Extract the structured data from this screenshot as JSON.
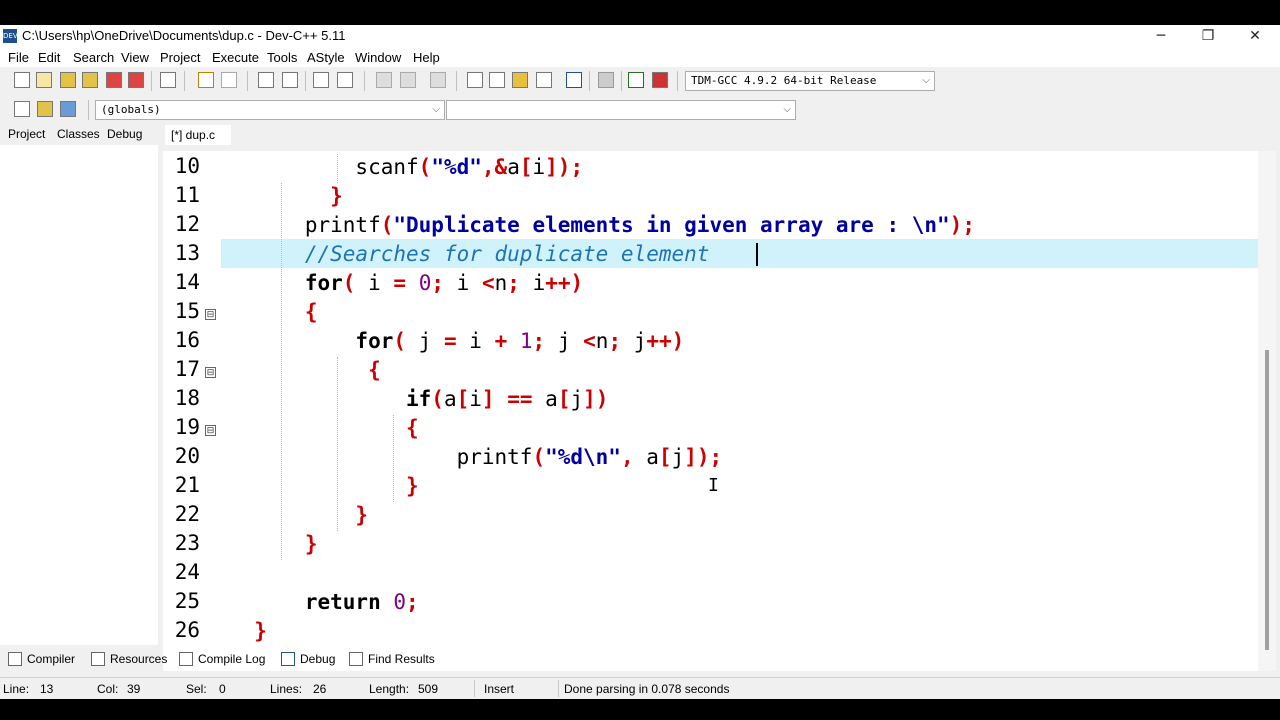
{
  "window": {
    "title": "C:\\Users\\hp\\OneDrive\\Documents\\dup.c - Dev-C++ 5.11",
    "app_icon": "DEV",
    "controls": [
      "─",
      "❐",
      "✕"
    ]
  },
  "menu": [
    "File",
    "Edit",
    "Search",
    "View",
    "Project",
    "Execute",
    "Tools",
    "AStyle",
    "Window",
    "Help"
  ],
  "toolbar": {
    "compiler_select": "TDM-GCC 4.9.2 64-bit Release",
    "scope_select": "(globals)",
    "function_select": ""
  },
  "left_tabs": [
    "Project",
    "Classes",
    "Debug"
  ],
  "editor_tab": "[*] dup.c",
  "editor": {
    "line_numbers": [
      "10",
      "11",
      "12",
      "13",
      "14",
      "15",
      "16",
      "17",
      "18",
      "19",
      "20",
      "21",
      "22",
      "23",
      "24",
      "25",
      "26"
    ],
    "fold_markers": [
      "⊟",
      "⊟",
      "⊟"
    ],
    "lines": [
      [
        {
          "t": "          scanf"
        },
        {
          "c": "sym",
          "t": "("
        },
        {
          "c": "str",
          "t": "\"%d\""
        },
        {
          "c": "sym",
          "t": ",&"
        },
        {
          "t": "a"
        },
        {
          "c": "sym",
          "t": "["
        },
        {
          "t": "i"
        },
        {
          "c": "sym",
          "t": "]);"
        }
      ],
      [
        {
          "c": "sym",
          "t": "        }"
        }
      ],
      [
        {
          "t": "      printf"
        },
        {
          "c": "sym",
          "t": "("
        },
        {
          "c": "str",
          "t": "\"Duplicate elements in given array are : \\n\""
        },
        {
          "c": "sym",
          "t": ");"
        }
      ],
      [
        {
          "c": "cm",
          "t": "      //Searches for duplicate element"
        }
      ],
      [
        {
          "c": "kw",
          "t": "      for"
        },
        {
          "c": "sym",
          "t": "("
        },
        {
          "t": " i "
        },
        {
          "c": "sym",
          "t": "="
        },
        {
          "t": " "
        },
        {
          "c": "num",
          "t": "0"
        },
        {
          "c": "sym",
          "t": ";"
        },
        {
          "t": " i "
        },
        {
          "c": "sym",
          "t": "<"
        },
        {
          "t": "n"
        },
        {
          "c": "sym",
          "t": ";"
        },
        {
          "t": " i"
        },
        {
          "c": "sym",
          "t": "++)"
        }
      ],
      [
        {
          "c": "sym",
          "t": "      {"
        }
      ],
      [
        {
          "c": "kw",
          "t": "          for"
        },
        {
          "c": "sym",
          "t": "("
        },
        {
          "t": " j "
        },
        {
          "c": "sym",
          "t": "="
        },
        {
          "t": " i "
        },
        {
          "c": "sym",
          "t": "+"
        },
        {
          "t": " "
        },
        {
          "c": "num",
          "t": "1"
        },
        {
          "c": "sym",
          "t": ";"
        },
        {
          "t": " j "
        },
        {
          "c": "sym",
          "t": "<"
        },
        {
          "t": "n"
        },
        {
          "c": "sym",
          "t": ";"
        },
        {
          "t": " j"
        },
        {
          "c": "sym",
          "t": "++)"
        }
      ],
      [
        {
          "c": "sym",
          "t": "           {"
        }
      ],
      [
        {
          "c": "kw",
          "t": "              if"
        },
        {
          "c": "sym",
          "t": "("
        },
        {
          "t": "a"
        },
        {
          "c": "sym",
          "t": "["
        },
        {
          "t": "i"
        },
        {
          "c": "sym",
          "t": "]"
        },
        {
          "t": " "
        },
        {
          "c": "sym",
          "t": "=="
        },
        {
          "t": " a"
        },
        {
          "c": "sym",
          "t": "["
        },
        {
          "t": "j"
        },
        {
          "c": "sym",
          "t": "])"
        }
      ],
      [
        {
          "c": "sym",
          "t": "              {"
        }
      ],
      [
        {
          "t": "                  printf"
        },
        {
          "c": "sym",
          "t": "("
        },
        {
          "c": "str",
          "t": "\"%d\\n\""
        },
        {
          "c": "sym",
          "t": ","
        },
        {
          "t": " a"
        },
        {
          "c": "sym",
          "t": "["
        },
        {
          "t": "j"
        },
        {
          "c": "sym",
          "t": "]);"
        }
      ],
      [
        {
          "c": "sym",
          "t": "              }"
        }
      ],
      [
        {
          "c": "sym",
          "t": "          }"
        }
      ],
      [
        {
          "c": "sym",
          "t": "      }"
        }
      ],
      [],
      [
        {
          "c": "kw",
          "t": "      return"
        },
        {
          "t": " "
        },
        {
          "c": "num",
          "t": "0"
        },
        {
          "c": "sym",
          "t": ";"
        }
      ],
      [
        {
          "c": "sym",
          "t": "  }"
        }
      ]
    ]
  },
  "bottom_tabs": [
    "Compiler",
    "Resources",
    "Compile Log",
    "Debug",
    "Find Results"
  ],
  "status": {
    "line_label": "Line:",
    "line_value": "13",
    "col_label": "Col:",
    "col_value": "39",
    "sel_label": "Sel:",
    "sel_value": "0",
    "lines_label": "Lines:",
    "lines_value": "26",
    "length_label": "Length:",
    "length_value": "509",
    "mode": "Insert",
    "message": "Done parsing in 0.078 seconds"
  },
  "colors": {
    "highlight_line": "#cff2fb",
    "keyword": "#000000",
    "symbol": "#cc0000",
    "string": "#0000a0",
    "number": "#800080",
    "comment": "#1e73b5"
  }
}
